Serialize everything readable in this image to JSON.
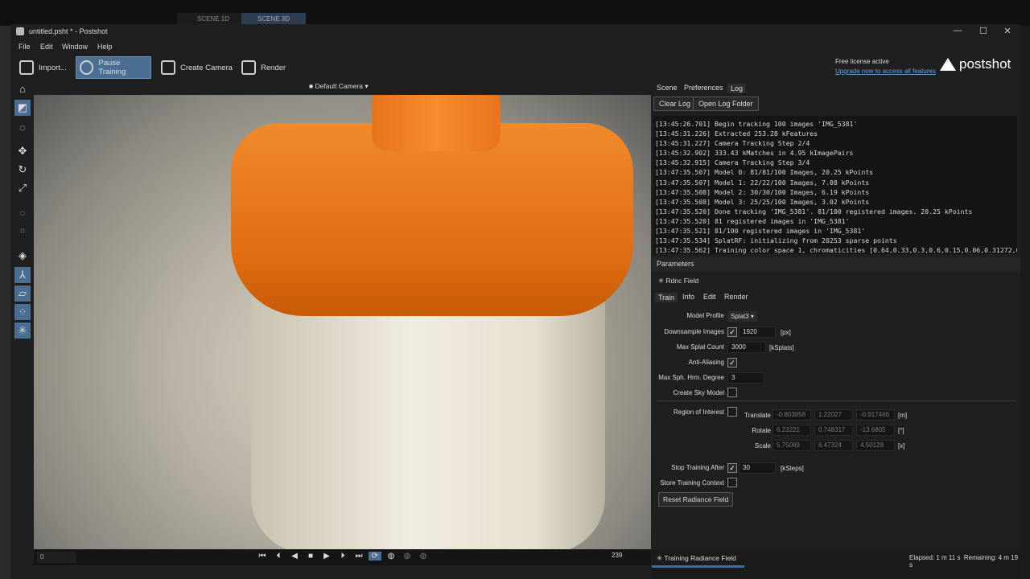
{
  "outer_tabs": {
    "scene1d": "SCENE 1D",
    "scene3d": "SCENE 3D"
  },
  "window": {
    "title": "untitled.psht * - Postshot",
    "minimize": "—",
    "maximize": "☐",
    "close": "✕"
  },
  "menu": {
    "file": "File",
    "edit": "Edit",
    "window": "Window",
    "help": "Help"
  },
  "toolbar": {
    "import": "Import...",
    "pause": "Pause Training",
    "create_camera": "Create Camera",
    "render": "Render"
  },
  "license": {
    "status": "Free license active",
    "upgrade": "Upgrade now to access all features"
  },
  "brand": {
    "name": "postshot"
  },
  "viewport": {
    "camera": "Default Camera",
    "frame_start": "0",
    "frame_end": "239"
  },
  "panel": {
    "tabs": {
      "scene": "Scene",
      "preferences": "Preferences",
      "log": "Log"
    },
    "clear_log": "Clear Log",
    "open_log_folder": "Open Log Folder",
    "log_lines": [
      "[13:45:26.701] Begin tracking 100 images 'IMG_5381'",
      "[13:45:31.226] Extracted 253.28 kFeatures",
      "[13:45:31.227] Camera Tracking Step 2/4",
      "[13:45:32.902] 333.43 kMatches in 4.95 kImagePairs",
      "[13:45:32.915] Camera Tracking Step 3/4",
      "[13:47:35.507] Model 0: 81/81/100 Images, 20.25 kPoints",
      "[13:47:35.507] Model 1: 22/22/100 Images, 7.08 kPoints",
      "[13:47:35.508] Model 2: 30/30/100 Images, 6.19 kPoints",
      "[13:47:35.508] Model 3: 25/25/100 Images, 3.02 kPoints",
      "[13:47:35.520] Done tracking 'IMG_5381'. 81/100 registered images. 20.25 kPoints",
      "[13:47:35.520] 81 registered images in 'IMG_5381'",
      "[13:47:35.521] 81/100 registered images in 'IMG_5381'",
      "[13:47:35.534] SplatRF: initializing from 20253 sparse points",
      "[13:47:35.562] Training color space 1, chromaticities [0.64,0.33,0.3,0.6,0.15,0.06,0.31272,0."
    ],
    "parameters": "Parameters",
    "rf_label": "Rdnc Field",
    "sub_tabs": {
      "train": "Train",
      "info": "Info",
      "edit": "Edit",
      "render": "Render"
    },
    "fields": {
      "model_profile": {
        "label": "Model Profile",
        "value": "Splat3"
      },
      "downsample": {
        "label": "Downsample Images",
        "value": "1920",
        "unit": "[px]",
        "checked": true
      },
      "max_splat": {
        "label": "Max Splat Count",
        "value": "3000",
        "unit": "[kSplats]"
      },
      "anti_aliasing": {
        "label": "Anti-Aliasing",
        "checked": true
      },
      "max_sph": {
        "label": "Max Sph. Hrm. Degree",
        "value": "3"
      },
      "sky_model": {
        "label": "Create Sky Model",
        "checked": false
      },
      "roi": {
        "label": "Region of Interest",
        "checked": false
      },
      "translate": {
        "label": "Translate",
        "values": [
          "-0.803858",
          "1.22027",
          "-0.917466"
        ],
        "unit": "[m]"
      },
      "rotate": {
        "label": "Rotate",
        "values": [
          "6.23221",
          "0.748317",
          "-13.6805"
        ],
        "unit": "[°]"
      },
      "scale": {
        "label": "Scale",
        "values": [
          "5.75089",
          "6.47324",
          "4.50128"
        ],
        "unit": "[x]"
      },
      "stop_training": {
        "label": "Stop Training After",
        "value": "30",
        "unit": "[kSteps]",
        "checked": true
      },
      "store_context": {
        "label": "Store Training Context",
        "checked": false
      }
    },
    "reset_button": "Reset Radiance Field"
  },
  "status": {
    "task": "Training Radiance Field",
    "elapsed": "Elapsed: 1 m 11 s",
    "remaining": "Remaining: 4 m 19 s",
    "progress": 0.25
  }
}
